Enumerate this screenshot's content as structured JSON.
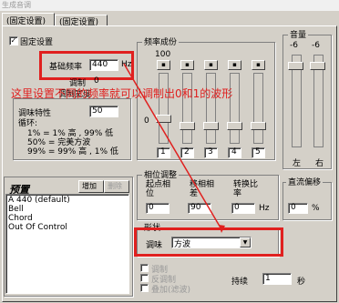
{
  "window": {
    "title": "生成音调"
  },
  "tabs": [
    {
      "label": "(固定设置)"
    },
    {
      "label": "(固定设置)"
    }
  ],
  "fixed_settings": {
    "checkbox_label": "固定设置",
    "checked": true
  },
  "base_freq": {
    "label": "基础频率",
    "value": "440",
    "unit": "Hz"
  },
  "modulation": {
    "label1": "调制",
    "value1": "0",
    "label2": "调制宽度"
  },
  "annotation": {
    "text": "这里设置不同的频率就可以调制出0和1的波形"
  },
  "tuning": {
    "label": "调味特性",
    "value": "50",
    "loop_label": "循环:",
    "lines": [
      "1% = 1% 高 , 99% 低",
      "50% = 完美方波",
      "99% = 99% 高 , 1% 低"
    ]
  },
  "freq_components": {
    "title": "频率成份",
    "scale_top": "100",
    "scale_zero": "0",
    "col_labels": [
      "1",
      "2",
      "3",
      "4",
      "5"
    ]
  },
  "volume": {
    "title": "音量",
    "scale": [
      "-6",
      "-6"
    ],
    "left": "左",
    "right": "右"
  },
  "presets": {
    "title": "预置",
    "add_button": "增加",
    "delete_button": "删除",
    "items": [
      "A 440 (default)",
      "Bell",
      "Chord",
      "Out Of Control"
    ]
  },
  "phase": {
    "title": "相位调整",
    "col1": "起点相位",
    "col2": "移相相差",
    "col3": "转换比率",
    "val1": "0",
    "val2": "90",
    "val3": "0",
    "unit": "Hz"
  },
  "dc_offset": {
    "title": "直流偏移",
    "value": "0",
    "unit": "%"
  },
  "shape": {
    "title": "形状",
    "label": "调味",
    "value": "方波"
  },
  "bottom": {
    "cb1": "调制",
    "cb2": "反调制",
    "cb3": "叠加(滤波)",
    "duration_label": "持续",
    "duration_value": "1",
    "duration_unit": "秒"
  },
  "colors": {
    "annotation": "#e0201f",
    "face": "#d4d0c8"
  }
}
